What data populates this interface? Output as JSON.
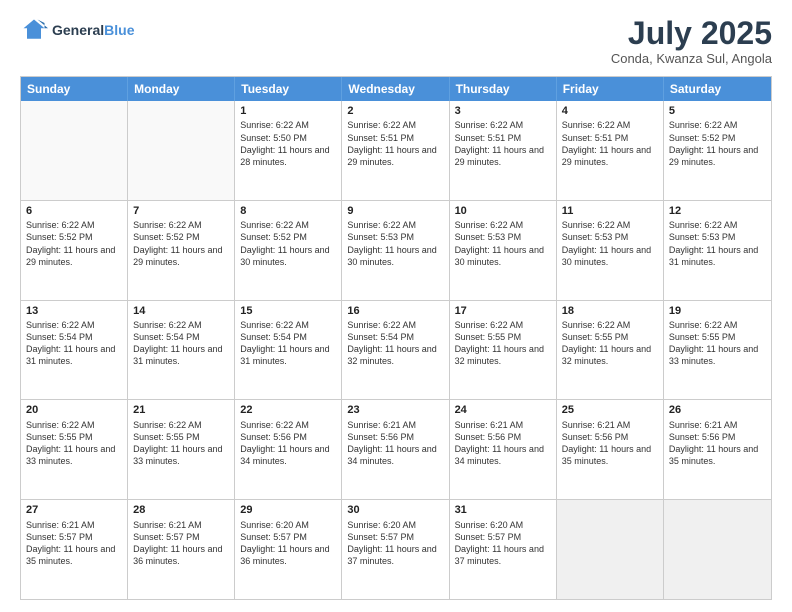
{
  "logo": {
    "line1": "General",
    "line2": "Blue"
  },
  "title": "July 2025",
  "location": "Conda, Kwanza Sul, Angola",
  "days": [
    "Sunday",
    "Monday",
    "Tuesday",
    "Wednesday",
    "Thursday",
    "Friday",
    "Saturday"
  ],
  "weeks": [
    [
      {
        "day": "",
        "detail": ""
      },
      {
        "day": "",
        "detail": ""
      },
      {
        "day": "1",
        "detail": "Sunrise: 6:22 AM\nSunset: 5:50 PM\nDaylight: 11 hours and 28 minutes."
      },
      {
        "day": "2",
        "detail": "Sunrise: 6:22 AM\nSunset: 5:51 PM\nDaylight: 11 hours and 29 minutes."
      },
      {
        "day": "3",
        "detail": "Sunrise: 6:22 AM\nSunset: 5:51 PM\nDaylight: 11 hours and 29 minutes."
      },
      {
        "day": "4",
        "detail": "Sunrise: 6:22 AM\nSunset: 5:51 PM\nDaylight: 11 hours and 29 minutes."
      },
      {
        "day": "5",
        "detail": "Sunrise: 6:22 AM\nSunset: 5:52 PM\nDaylight: 11 hours and 29 minutes."
      }
    ],
    [
      {
        "day": "6",
        "detail": "Sunrise: 6:22 AM\nSunset: 5:52 PM\nDaylight: 11 hours and 29 minutes."
      },
      {
        "day": "7",
        "detail": "Sunrise: 6:22 AM\nSunset: 5:52 PM\nDaylight: 11 hours and 29 minutes."
      },
      {
        "day": "8",
        "detail": "Sunrise: 6:22 AM\nSunset: 5:52 PM\nDaylight: 11 hours and 30 minutes."
      },
      {
        "day": "9",
        "detail": "Sunrise: 6:22 AM\nSunset: 5:53 PM\nDaylight: 11 hours and 30 minutes."
      },
      {
        "day": "10",
        "detail": "Sunrise: 6:22 AM\nSunset: 5:53 PM\nDaylight: 11 hours and 30 minutes."
      },
      {
        "day": "11",
        "detail": "Sunrise: 6:22 AM\nSunset: 5:53 PM\nDaylight: 11 hours and 30 minutes."
      },
      {
        "day": "12",
        "detail": "Sunrise: 6:22 AM\nSunset: 5:53 PM\nDaylight: 11 hours and 31 minutes."
      }
    ],
    [
      {
        "day": "13",
        "detail": "Sunrise: 6:22 AM\nSunset: 5:54 PM\nDaylight: 11 hours and 31 minutes."
      },
      {
        "day": "14",
        "detail": "Sunrise: 6:22 AM\nSunset: 5:54 PM\nDaylight: 11 hours and 31 minutes."
      },
      {
        "day": "15",
        "detail": "Sunrise: 6:22 AM\nSunset: 5:54 PM\nDaylight: 11 hours and 31 minutes."
      },
      {
        "day": "16",
        "detail": "Sunrise: 6:22 AM\nSunset: 5:54 PM\nDaylight: 11 hours and 32 minutes."
      },
      {
        "day": "17",
        "detail": "Sunrise: 6:22 AM\nSunset: 5:55 PM\nDaylight: 11 hours and 32 minutes."
      },
      {
        "day": "18",
        "detail": "Sunrise: 6:22 AM\nSunset: 5:55 PM\nDaylight: 11 hours and 32 minutes."
      },
      {
        "day": "19",
        "detail": "Sunrise: 6:22 AM\nSunset: 5:55 PM\nDaylight: 11 hours and 33 minutes."
      }
    ],
    [
      {
        "day": "20",
        "detail": "Sunrise: 6:22 AM\nSunset: 5:55 PM\nDaylight: 11 hours and 33 minutes."
      },
      {
        "day": "21",
        "detail": "Sunrise: 6:22 AM\nSunset: 5:55 PM\nDaylight: 11 hours and 33 minutes."
      },
      {
        "day": "22",
        "detail": "Sunrise: 6:22 AM\nSunset: 5:56 PM\nDaylight: 11 hours and 34 minutes."
      },
      {
        "day": "23",
        "detail": "Sunrise: 6:21 AM\nSunset: 5:56 PM\nDaylight: 11 hours and 34 minutes."
      },
      {
        "day": "24",
        "detail": "Sunrise: 6:21 AM\nSunset: 5:56 PM\nDaylight: 11 hours and 34 minutes."
      },
      {
        "day": "25",
        "detail": "Sunrise: 6:21 AM\nSunset: 5:56 PM\nDaylight: 11 hours and 35 minutes."
      },
      {
        "day": "26",
        "detail": "Sunrise: 6:21 AM\nSunset: 5:56 PM\nDaylight: 11 hours and 35 minutes."
      }
    ],
    [
      {
        "day": "27",
        "detail": "Sunrise: 6:21 AM\nSunset: 5:57 PM\nDaylight: 11 hours and 35 minutes."
      },
      {
        "day": "28",
        "detail": "Sunrise: 6:21 AM\nSunset: 5:57 PM\nDaylight: 11 hours and 36 minutes."
      },
      {
        "day": "29",
        "detail": "Sunrise: 6:20 AM\nSunset: 5:57 PM\nDaylight: 11 hours and 36 minutes."
      },
      {
        "day": "30",
        "detail": "Sunrise: 6:20 AM\nSunset: 5:57 PM\nDaylight: 11 hours and 37 minutes."
      },
      {
        "day": "31",
        "detail": "Sunrise: 6:20 AM\nSunset: 5:57 PM\nDaylight: 11 hours and 37 minutes."
      },
      {
        "day": "",
        "detail": ""
      },
      {
        "day": "",
        "detail": ""
      }
    ]
  ]
}
